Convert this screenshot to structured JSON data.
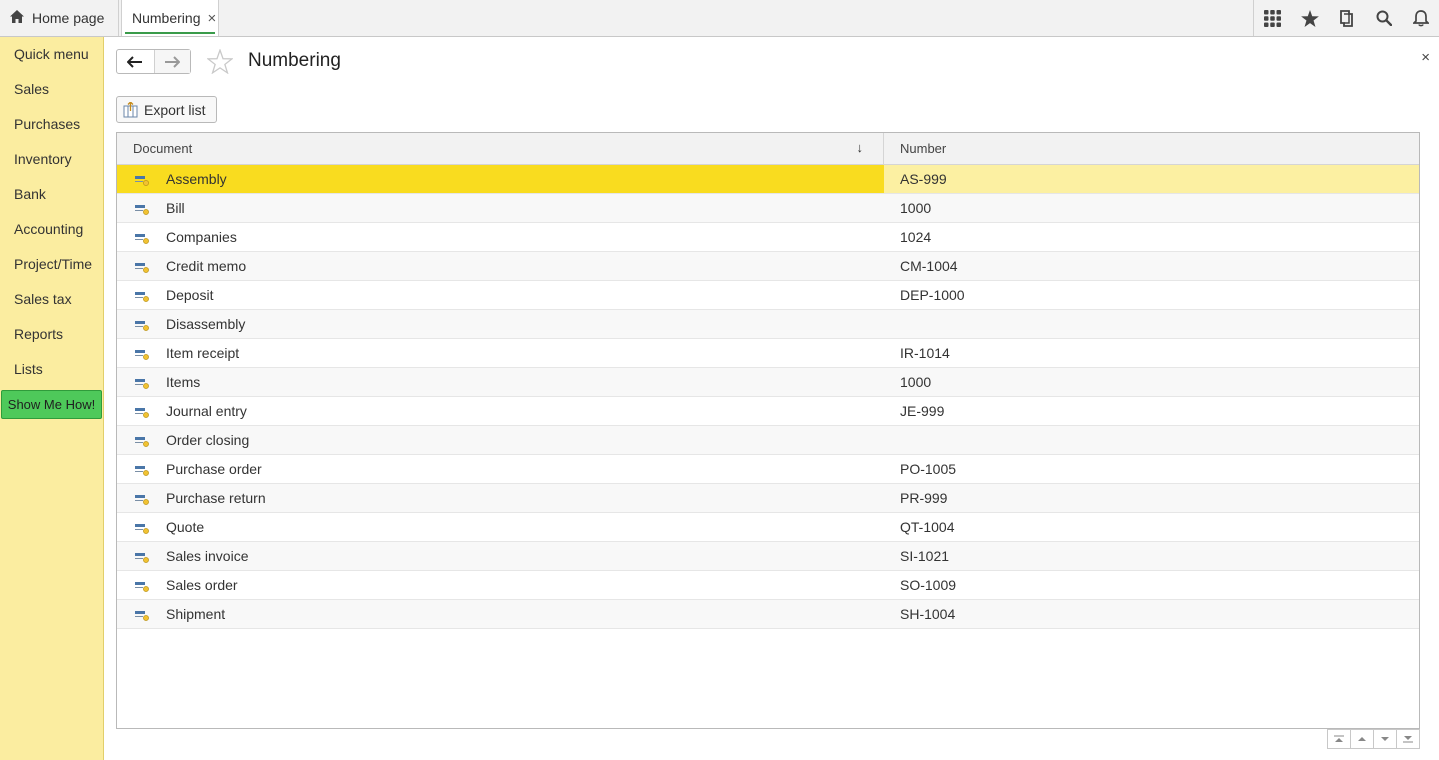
{
  "tabs": {
    "home_label": "Home page",
    "active_label": "Numbering",
    "close_glyph": "×"
  },
  "top_icons": [
    "apps-grid-icon",
    "favorites-star-icon",
    "history-icon",
    "search-icon",
    "notifications-bell-icon"
  ],
  "sidebar": {
    "items": [
      {
        "label": "Quick menu"
      },
      {
        "label": "Sales"
      },
      {
        "label": "Purchases"
      },
      {
        "label": "Inventory"
      },
      {
        "label": "Bank"
      },
      {
        "label": "Accounting"
      },
      {
        "label": "Project/Time"
      },
      {
        "label": "Sales tax"
      },
      {
        "label": "Reports"
      },
      {
        "label": "Lists"
      }
    ],
    "show_me_label": "Show Me How!"
  },
  "page": {
    "title": "Numbering",
    "close_glyph": "×",
    "export_label": "Export list"
  },
  "table": {
    "columns": {
      "document": "Document",
      "number": "Number",
      "sort_glyph": "↓"
    },
    "rows": [
      {
        "document": "Assembly",
        "number": "AS-999",
        "selected": true
      },
      {
        "document": "Bill",
        "number": "1000"
      },
      {
        "document": "Companies",
        "number": "1024"
      },
      {
        "document": "Credit memo",
        "number": "CM-1004"
      },
      {
        "document": "Deposit",
        "number": "DEP-1000"
      },
      {
        "document": "Disassembly",
        "number": ""
      },
      {
        "document": "Item receipt",
        "number": "IR-1014"
      },
      {
        "document": "Items",
        "number": "1000"
      },
      {
        "document": "Journal entry",
        "number": "JE-999"
      },
      {
        "document": "Order closing",
        "number": ""
      },
      {
        "document": "Purchase order",
        "number": "PO-1005"
      },
      {
        "document": "Purchase return",
        "number": "PR-999"
      },
      {
        "document": "Quote",
        "number": "QT-1004"
      },
      {
        "document": "Sales invoice",
        "number": "SI-1021"
      },
      {
        "document": "Sales order",
        "number": "SO-1009"
      },
      {
        "document": "Shipment",
        "number": "SH-1004"
      }
    ]
  },
  "colors": {
    "sidebar_bg": "#fbeda0",
    "show_me_bg": "#4ec95a",
    "selected_row": "#f9dc1f",
    "active_tab_underline": "#3a9b4a"
  }
}
